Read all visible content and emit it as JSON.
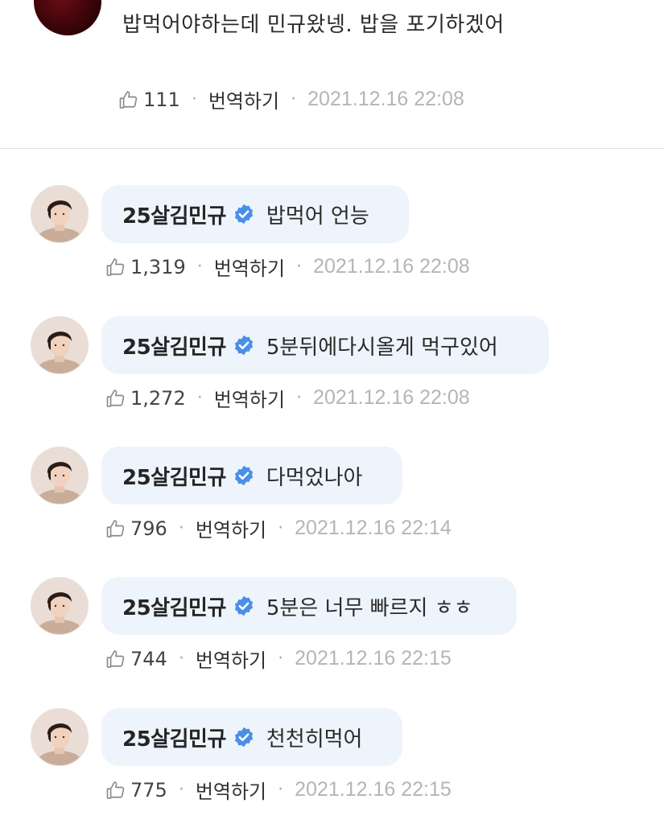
{
  "top_comment": {
    "text": "밥먹어야하는데 민규왔넹. 밥을 포기하겠어",
    "likes": "111",
    "translate_label": "번역하기",
    "timestamp": "2021.12.16 22:08"
  },
  "replies": [
    {
      "author": "25살김민규",
      "message": "밥먹어 언능",
      "likes": "1,319",
      "translate_label": "번역하기",
      "timestamp": "2021.12.16 22:08"
    },
    {
      "author": "25살김민규",
      "message": "5분뒤에다시올게 먹구있어",
      "likes": "1,272",
      "translate_label": "번역하기",
      "timestamp": "2021.12.16 22:08"
    },
    {
      "author": "25살김민규",
      "message": "다먹었나아",
      "likes": "796",
      "translate_label": "번역하기",
      "timestamp": "2021.12.16 22:14"
    },
    {
      "author": "25살김민규",
      "message": "5분은 너무 빠르지 ㅎㅎ",
      "likes": "744",
      "translate_label": "번역하기",
      "timestamp": "2021.12.16 22:15"
    },
    {
      "author": "25살김민규",
      "message": "천천히먹어",
      "likes": "775",
      "translate_label": "번역하기",
      "timestamp": "2021.12.16 22:15"
    }
  ],
  "icons": {
    "like": "thumbs-up-icon",
    "verified": "verified-badge-icon"
  },
  "colors": {
    "bubble_background": "#eef4fb",
    "verified_badge": "#4a8fe7",
    "timestamp": "#b5b5b5"
  }
}
